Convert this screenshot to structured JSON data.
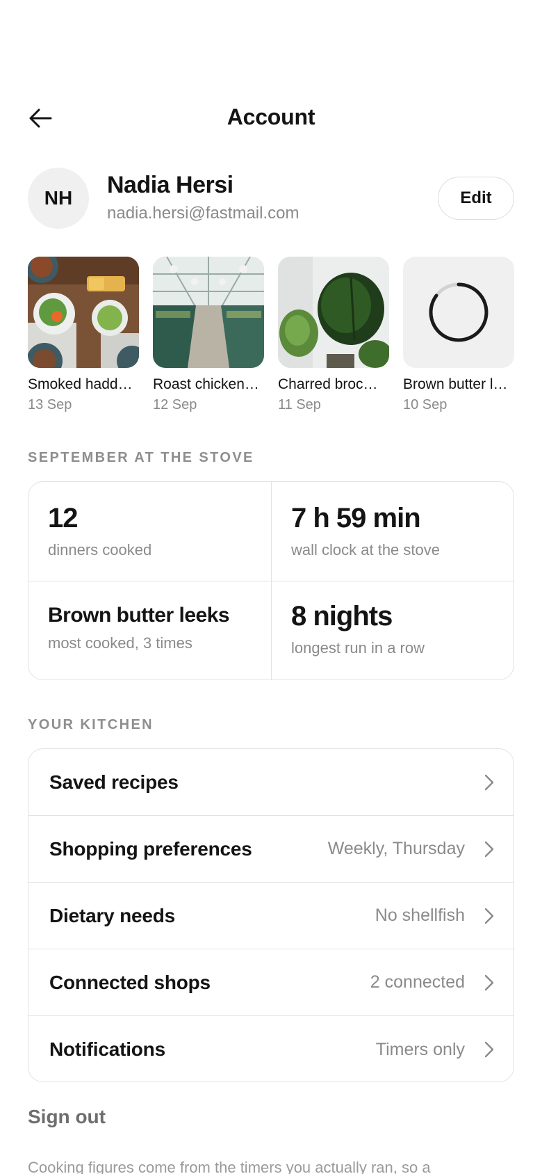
{
  "header": {
    "title": "Account",
    "back_icon": "arrow-left-icon"
  },
  "profile": {
    "initials": "NH",
    "name": "Nadia Hersi",
    "email": "nadia.hersi@fastmail.com",
    "edit_label": "Edit"
  },
  "recent": [
    {
      "title": "Smoked hadd…",
      "date": "13 Sep"
    },
    {
      "title": "Roast chicken…",
      "date": "12 Sep"
    },
    {
      "title": "Charred broc…",
      "date": "11 Sep"
    },
    {
      "title": "Brown butter l…",
      "date": "10 Sep"
    }
  ],
  "stats_section": {
    "label": "SEPTEMBER AT THE STOVE",
    "items": [
      {
        "value": "12",
        "caption": "dinners cooked"
      },
      {
        "value": "7 h 59 min",
        "caption": "wall clock at the stove"
      },
      {
        "value": "Brown butter leeks",
        "caption": "most cooked, 3 times"
      },
      {
        "value": "8 nights",
        "caption": "longest run in a row"
      }
    ]
  },
  "kitchen_section": {
    "label": "YOUR KITCHEN",
    "rows": [
      {
        "label": "Saved recipes",
        "value": ""
      },
      {
        "label": "Shopping preferences",
        "value": "Weekly, Thursday"
      },
      {
        "label": "Dietary needs",
        "value": "No shellfish"
      },
      {
        "label": "Connected shops",
        "value": "2 connected"
      },
      {
        "label": "Notifications",
        "value": "Timers only"
      }
    ]
  },
  "signout_label": "Sign out",
  "footnote": "Cooking figures come from the timers you actually ran, so a"
}
